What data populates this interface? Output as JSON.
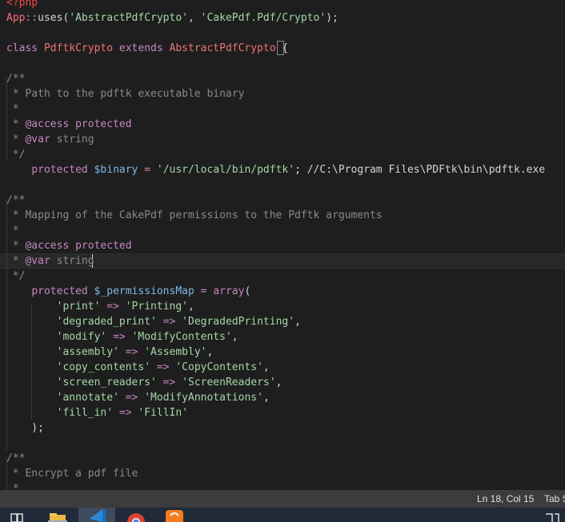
{
  "editor": {
    "lines": [
      [
        [
          "<?php",
          "tag"
        ]
      ],
      [
        [
          "App",
          "cls2"
        ],
        [
          "::",
          "op"
        ],
        [
          "uses",
          "fn"
        ],
        [
          "(",
          "plain"
        ],
        [
          "'AbstractPdfCrypto'",
          "str"
        ],
        [
          ", ",
          "plain"
        ],
        [
          "'CakePdf.Pdf/Crypto'",
          "str"
        ],
        [
          ");",
          "plain"
        ]
      ],
      [],
      [
        [
          "class ",
          "kw"
        ],
        [
          "PdftkCrypto",
          "cls2"
        ],
        [
          " extends ",
          "kw"
        ],
        [
          "AbstractPdfCrypto",
          "cls2"
        ],
        [
          " ",
          "plain"
        ],
        [
          "{",
          "plain"
        ]
      ],
      [],
      [
        [
          "/**",
          "doc"
        ]
      ],
      [
        [
          " * Path to the pdftk executable binary",
          "doc"
        ]
      ],
      [
        [
          " *",
          "doc"
        ]
      ],
      [
        [
          " * ",
          "doc"
        ],
        [
          "@access",
          "tagkw"
        ],
        [
          " ",
          "doc"
        ],
        [
          "protected",
          "kw"
        ]
      ],
      [
        [
          " * ",
          "doc"
        ],
        [
          "@var",
          "tagkw"
        ],
        [
          " string",
          "doc"
        ]
      ],
      [
        [
          " */",
          "doc"
        ]
      ],
      [
        [
          "    ",
          "plain"
        ],
        [
          "protected",
          "kw"
        ],
        [
          " ",
          "plain"
        ],
        [
          "$binary",
          "var"
        ],
        [
          " = ",
          "op"
        ],
        [
          "'/usr/local/bin/pdftk'",
          "str"
        ],
        [
          "; ",
          "plain"
        ],
        [
          "//C:\\Program Files\\PDFtk\\bin\\pdftk.exe",
          "plain"
        ]
      ],
      [],
      [
        [
          "/**",
          "doc"
        ]
      ],
      [
        [
          " * Mapping of the CakePdf permissions to the Pdftk arguments",
          "doc"
        ]
      ],
      [
        [
          " *",
          "doc"
        ]
      ],
      [
        [
          " * ",
          "doc"
        ],
        [
          "@access",
          "tagkw"
        ],
        [
          " ",
          "doc"
        ],
        [
          "protected",
          "kw"
        ]
      ],
      [
        [
          " * ",
          "doc"
        ],
        [
          "@var",
          "tagkw"
        ],
        [
          " string",
          "doc"
        ]
      ],
      [
        [
          " */",
          "doc"
        ]
      ],
      [
        [
          "    ",
          "plain"
        ],
        [
          "protected",
          "kw"
        ],
        [
          " ",
          "plain"
        ],
        [
          "$_permissionsMap",
          "var"
        ],
        [
          " = ",
          "op"
        ],
        [
          "array",
          "kw"
        ],
        [
          "(",
          "plain"
        ]
      ],
      [
        [
          "        ",
          "plain"
        ],
        [
          "'print'",
          "str"
        ],
        [
          " => ",
          "op"
        ],
        [
          "'Printing'",
          "str"
        ],
        [
          ",",
          "plain"
        ]
      ],
      [
        [
          "        ",
          "plain"
        ],
        [
          "'degraded_print'",
          "str"
        ],
        [
          " => ",
          "op"
        ],
        [
          "'DegradedPrinting'",
          "str"
        ],
        [
          ",",
          "plain"
        ]
      ],
      [
        [
          "        ",
          "plain"
        ],
        [
          "'modify'",
          "str"
        ],
        [
          " => ",
          "op"
        ],
        [
          "'ModifyContents'",
          "str"
        ],
        [
          ",",
          "plain"
        ]
      ],
      [
        [
          "        ",
          "plain"
        ],
        [
          "'assembly'",
          "str"
        ],
        [
          " => ",
          "op"
        ],
        [
          "'Assembly'",
          "str"
        ],
        [
          ",",
          "plain"
        ]
      ],
      [
        [
          "        ",
          "plain"
        ],
        [
          "'copy_contents'",
          "str"
        ],
        [
          " => ",
          "op"
        ],
        [
          "'CopyContents'",
          "str"
        ],
        [
          ",",
          "plain"
        ]
      ],
      [
        [
          "        ",
          "plain"
        ],
        [
          "'screen_readers'",
          "str"
        ],
        [
          " => ",
          "op"
        ],
        [
          "'ScreenReaders'",
          "str"
        ],
        [
          ",",
          "plain"
        ]
      ],
      [
        [
          "        ",
          "plain"
        ],
        [
          "'annotate'",
          "str"
        ],
        [
          " => ",
          "op"
        ],
        [
          "'ModifyAnnotations'",
          "str"
        ],
        [
          ",",
          "plain"
        ]
      ],
      [
        [
          "        ",
          "plain"
        ],
        [
          "'fill_in'",
          "str"
        ],
        [
          " => ",
          "op"
        ],
        [
          "'FillIn'",
          "str"
        ]
      ],
      [
        [
          "    );",
          "plain"
        ]
      ],
      [],
      [
        [
          "/**",
          "doc"
        ]
      ],
      [
        [
          " * Encrypt a pdf file",
          "doc"
        ]
      ],
      [
        [
          " *",
          "doc"
        ]
      ]
    ]
  },
  "statusbar": {
    "position": "Ln 18, Col 15",
    "tab": "Tab S"
  },
  "taskbar": {
    "apps": [
      "task-view-icon",
      "file-explorer-icon",
      "vscode-icon",
      "chrome-icon",
      "xampp-icon"
    ],
    "right_icons": [
      "notification-icon"
    ]
  },
  "colors": {
    "background": "#1e1e1e",
    "statusbar": "#3c3c3c",
    "taskbar": "#202a38"
  }
}
